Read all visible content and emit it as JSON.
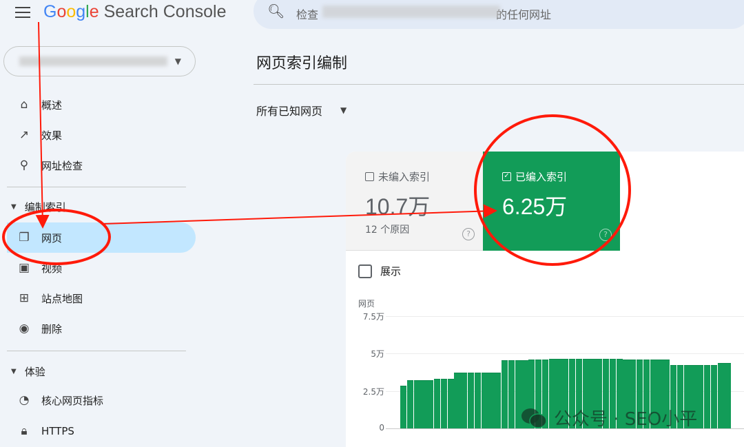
{
  "header": {
    "logo_google": "Google",
    "logo_product": "Search Console",
    "search_placeholder_start": "检查",
    "search_placeholder_end": "的任何网址",
    "menu_icon": "hamburger-icon",
    "search_icon": "search-icon"
  },
  "sidebar": {
    "items": [
      {
        "label": "概述",
        "icon": "home-icon"
      },
      {
        "label": "效果",
        "icon": "trending-up-icon"
      },
      {
        "label": "网址检查",
        "icon": "search-icon"
      }
    ],
    "section_index": {
      "label": "编制索引",
      "items": [
        {
          "label": "网页",
          "icon": "pages-icon",
          "selected": true
        },
        {
          "label": "视频",
          "icon": "video-icon"
        },
        {
          "label": "站点地图",
          "icon": "sitemap-icon"
        },
        {
          "label": "删除",
          "icon": "visibility-off-icon"
        }
      ]
    },
    "section_experience": {
      "label": "体验",
      "items": [
        {
          "label": "核心网页指标",
          "icon": "speed-gauge-icon"
        },
        {
          "label": "HTTPS",
          "icon": "lock-icon"
        }
      ]
    }
  },
  "main": {
    "title": "网页索引编制",
    "filter": "所有已知网页",
    "cards": [
      {
        "label": "未编入索引",
        "value": "10.7万",
        "sub": "12 个原因",
        "checked": false
      },
      {
        "label": "已编入索引",
        "value": "6.25万",
        "checked": true
      }
    ],
    "show_label": "展示",
    "help_symbol": "?"
  },
  "colors": {
    "indexed": "#129c58",
    "selected_nav": "#c2e7ff",
    "annotation": "#ff1a0a"
  },
  "chart_data": {
    "type": "bar",
    "ylabel": "网页",
    "ylim": [
      0,
      75000
    ],
    "yticks": [
      {
        "value": 75000,
        "label": "7.5万"
      },
      {
        "value": 50000,
        "label": "5万"
      },
      {
        "value": 25000,
        "label": "2.5万"
      },
      {
        "value": 0,
        "label": "0"
      }
    ],
    "grid": true,
    "values": [
      28500,
      32200,
      32200,
      32200,
      32200,
      33000,
      33000,
      33000,
      37300,
      37300,
      37300,
      37300,
      37300,
      37300,
      37300,
      45500,
      45500,
      45500,
      45500,
      46100,
      46100,
      46100,
      46600,
      46600,
      46600,
      46600,
      46600,
      46600,
      46600,
      46600,
      46600,
      46600,
      46600,
      46100,
      46100,
      46100,
      46100,
      46100,
      46100,
      46100,
      42400,
      42400,
      42400,
      42400,
      42400,
      42400,
      42400,
      43500,
      43500
    ],
    "color": "#129c58"
  },
  "watermark": "公众号 · SEO小平"
}
